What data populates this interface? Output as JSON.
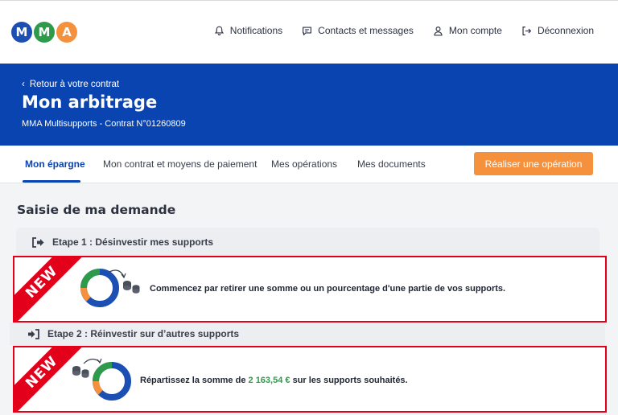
{
  "logo": {
    "letters": [
      "M",
      "M",
      "A"
    ],
    "colors": [
      "#1b4fb3",
      "#2e9b4a",
      "#f5913c"
    ]
  },
  "nav": {
    "notifications": "Notifications",
    "contacts": "Contacts et messages",
    "account": "Mon compte",
    "logout": "Déconnexion"
  },
  "banner": {
    "back": "Retour à votre contrat",
    "title": "Mon arbitrage",
    "subtitle": "MMA Multisupports - Contrat N°01260809"
  },
  "tabs": {
    "items": [
      "Mon épargne",
      "Mon contrat et moyens de paiement",
      "Mes opérations",
      "Mes documents"
    ],
    "active_index": 0,
    "cta": "Réaliser une opération"
  },
  "content": {
    "section_title": "Saisie de ma demande",
    "step1": {
      "title": "Etape 1 : Désinvestir mes supports",
      "badge": "NEW",
      "text": "Commencez par retirer une somme ou un pourcentage d'une partie de vos supports."
    },
    "step2": {
      "title": "Etape 2 : Réinvestir sur d’autres supports",
      "badge": "NEW",
      "text_before": "Répartissez la somme de ",
      "amount": "2 163,54 €",
      "text_after": " sur les supports souhaités."
    }
  },
  "colors": {
    "primary": "#0a44b0",
    "accent": "#f5913c",
    "highlight": "#e3001b",
    "green": "#2e9b4a"
  }
}
